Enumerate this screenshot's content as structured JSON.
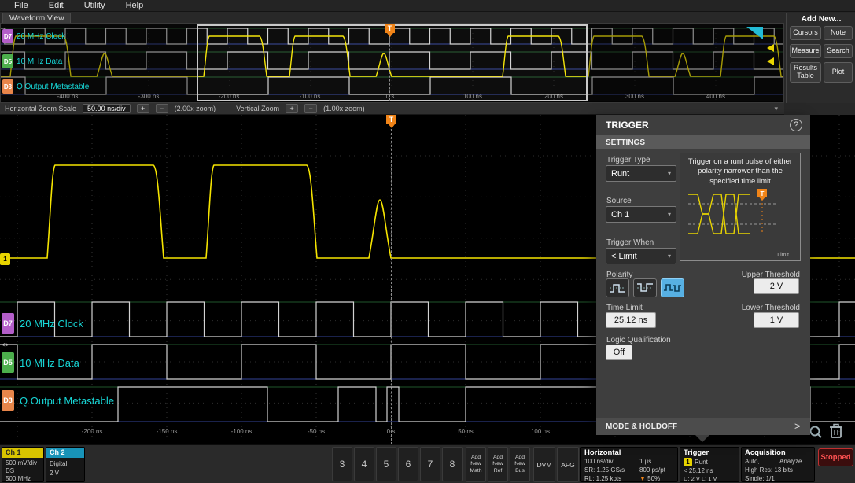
{
  "colors": {
    "accent_blue": "#57b0e3",
    "ch1_yellow": "#e8d400",
    "d7_purple": "#b45ec9",
    "d5_green": "#4cae4c",
    "d3_orange": "#e8854a",
    "trigger_orange": "#f08418",
    "cyan_label": "#17d6d6",
    "stopped_red": "#ff5252"
  },
  "menu": {
    "items": [
      "File",
      "Edit",
      "Utility",
      "Help"
    ]
  },
  "tabs": {
    "waveform_view": "Waveform View"
  },
  "channels": [
    {
      "badge": "D7",
      "label": "20 MHz Clock"
    },
    {
      "badge": "D5",
      "label": "10 MHz Data"
    },
    {
      "badge": "D3",
      "label": "Q Output Metastable"
    }
  ],
  "overview": {
    "time_labels": [
      "-400 ns",
      "-300 ns",
      "-200 ns",
      "-100 ns",
      "0 s",
      "100 ns",
      "200 ns",
      "300 ns",
      "400 ns"
    ],
    "trigger_flag": "T"
  },
  "main_view": {
    "time_labels": [
      "-200 ns",
      "-150 ns",
      "-100 ns",
      "-50 ns",
      "0 s",
      "50 ns",
      "100 ns"
    ],
    "trigger_flag": "T"
  },
  "add_new": {
    "title": "Add New...",
    "buttons": [
      "Cursors",
      "Note",
      "Measure",
      "Search",
      "Results Table",
      "Plot"
    ]
  },
  "zoom_bar": {
    "h_label": "Horizontal Zoom Scale",
    "h_value": "50.00 ns/div",
    "plus": "+",
    "minus": "−",
    "h_zoom": "(2.00x zoom)",
    "v_label": "Vertical Zoom",
    "v_zoom": "(1.00x zoom)",
    "collapse": "▾"
  },
  "trigger_panel": {
    "title": "TRIGGER",
    "help": "?",
    "settings": "SETTINGS",
    "type_label": "Trigger Type",
    "type_value": "Runt",
    "description": "Trigger on a runt pulse of either polarity narrower than the specified time limit",
    "diagram_caption": "Limit",
    "source_label": "Source",
    "source_value": "Ch 1",
    "when_label": "Trigger When",
    "when_value": "< Limit",
    "polarity_label": "Polarity",
    "upper_label": "Upper Threshold",
    "upper_value": "2 V",
    "time_limit_label": "Time Limit",
    "time_limit_value": "25.12 ns",
    "lower_label": "Lower Threshold",
    "lower_value": "1 V",
    "logic_label": "Logic Qualification",
    "logic_value": "Off",
    "mode_holdoff": "MODE & HOLDOFF",
    "expand": ">"
  },
  "status_bar": {
    "ch1": {
      "name": "Ch 1",
      "line1": "500 mV/div",
      "line2": "DS",
      "line3": "500 MHz"
    },
    "ch2": {
      "name": "Ch 2",
      "line1": "Digital",
      "line2": "2 V"
    },
    "channel_buttons": [
      "3",
      "4",
      "5",
      "6",
      "7",
      "8"
    ],
    "add_math": "Add New Math",
    "add_ref": "Add New Ref",
    "add_bus": "Add New Bus",
    "dvm": "DVM",
    "afg": "AFG",
    "horizontal": {
      "title": "Horizontal",
      "scale": "100 ns/div",
      "window": "1 µs",
      "sr": "SR: 1.25 GS/s",
      "res": "800 ps/pt",
      "rl": "RL: 1.25 kpts",
      "pos": "50%"
    },
    "trigger": {
      "title": "Trigger",
      "badge": "1",
      "type": "Runt",
      "limit": "< 25.12 ns",
      "levels": "U: 2 V  L: 1 V"
    },
    "acquisition": {
      "title": "Acquisition",
      "mode": "Auto,",
      "analyze": "Analyze",
      "res": "High Res: 13 bits",
      "single": "Single: 1/1"
    },
    "run_state": "Stopped"
  }
}
